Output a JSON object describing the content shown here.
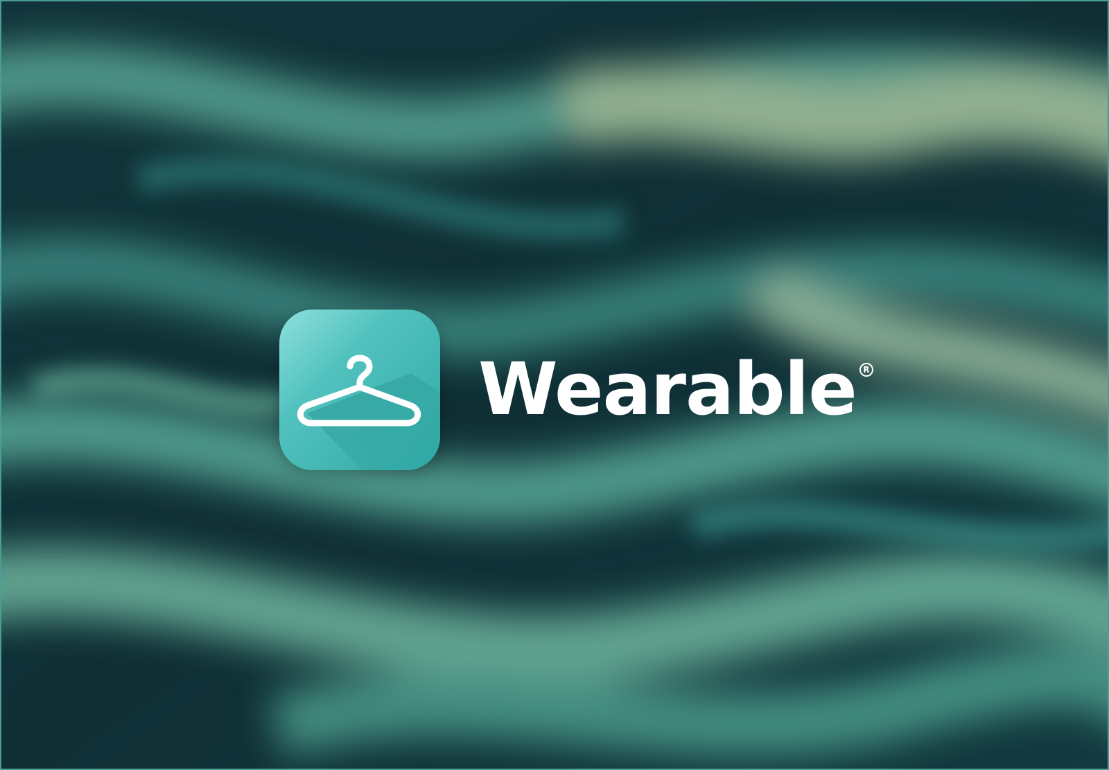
{
  "brand": {
    "name": "Wearable",
    "registered_mark": "R",
    "icon": "hanger-icon"
  },
  "colors": {
    "background_dark": "#0f3137",
    "background_light": "#7fc9b6",
    "icon_gradient_start": "#8fe0dc",
    "icon_gradient_end": "#2fa8a5",
    "text": "#ffffff"
  }
}
